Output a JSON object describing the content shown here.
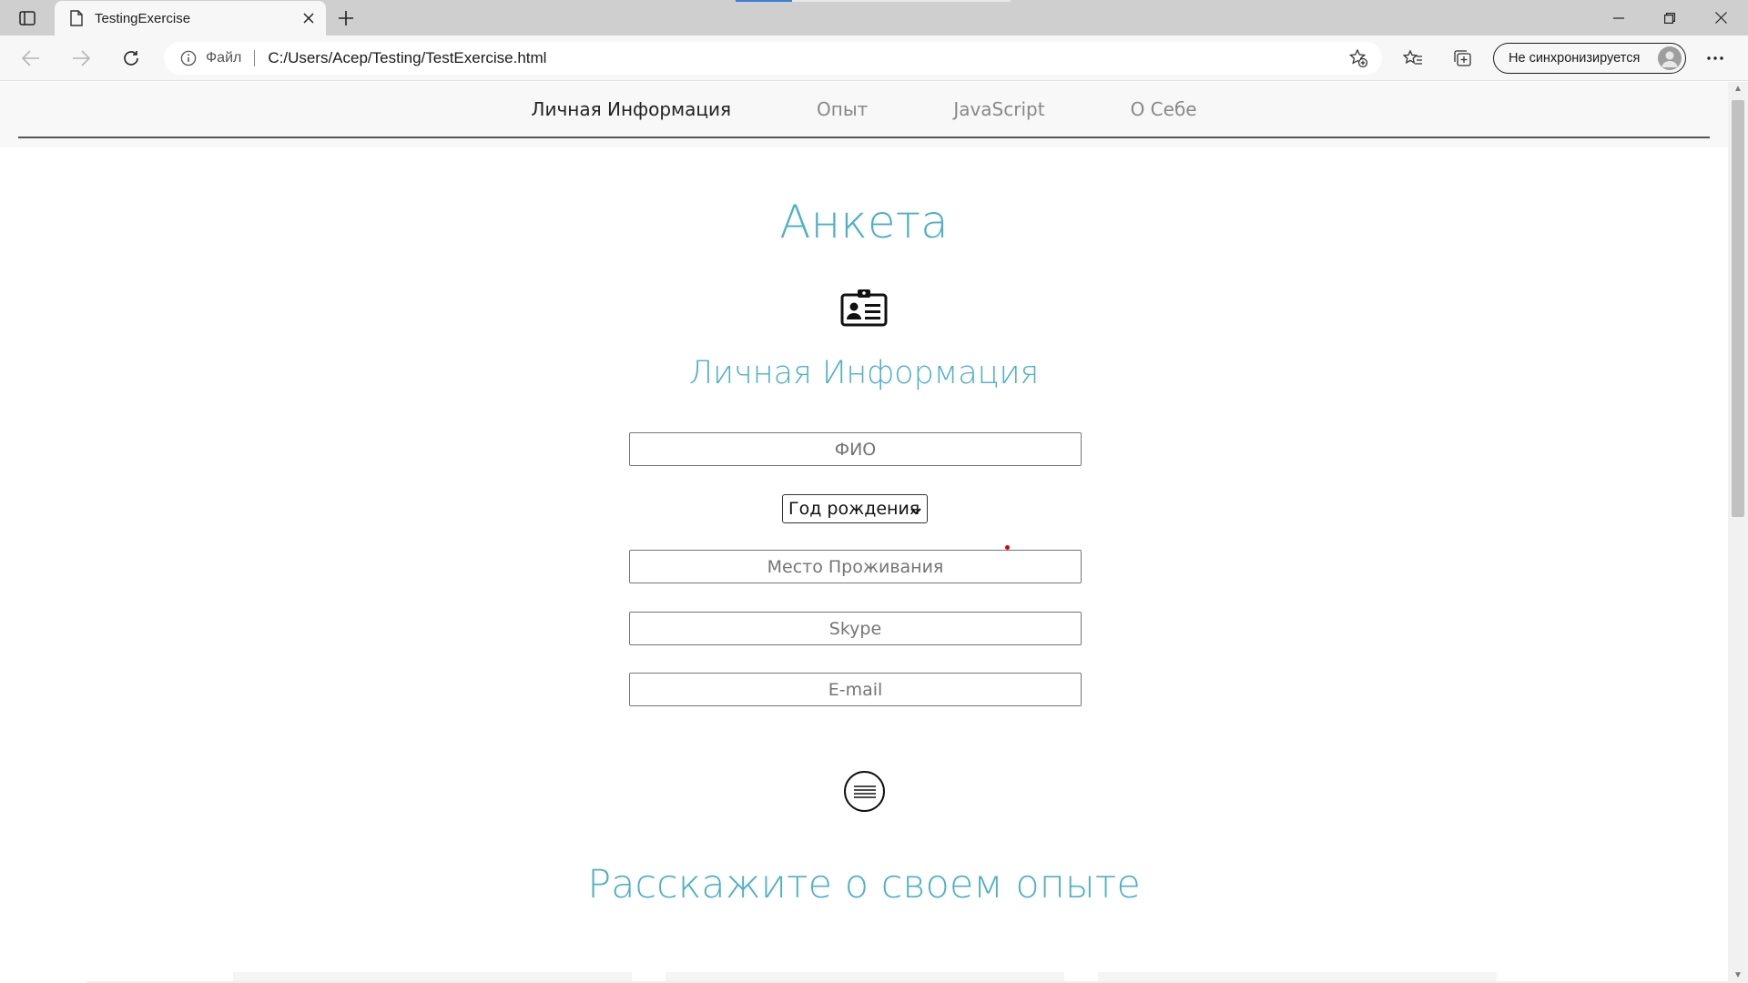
{
  "browser": {
    "tab_title": "TestingExercise",
    "address_scheme": "Файл",
    "address_url": "C:/Users/Acep/Testing/TestExercise.html",
    "profile_label": "Не синхронизируется",
    "icons": [
      "tab-actions-icon",
      "page-icon",
      "close-icon",
      "plus-icon",
      "minimize-icon",
      "restore-icon",
      "close-window-icon",
      "back-arrow-icon",
      "forward-arrow-icon",
      "refresh-icon",
      "info-icon",
      "add-favorite-icon",
      "favorites-icon",
      "collections-icon",
      "more-icon"
    ]
  },
  "nav": {
    "items": [
      {
        "label": "Личная Информация",
        "active": true
      },
      {
        "label": "Опыт",
        "active": false
      },
      {
        "label": "JavaScript",
        "active": false
      },
      {
        "label": "О Себе",
        "active": false
      }
    ]
  },
  "page": {
    "title": "Анкета",
    "section_title": "Личная Информация",
    "fields": {
      "fio_placeholder": "ФИО",
      "birth_year": "Год рождения",
      "residence_placeholder": "Место Проживания",
      "skype_placeholder": "Skype",
      "email_placeholder": "E-mail"
    },
    "experience_title": "Расскажите о своем опыте"
  },
  "colors": {
    "accent": "#4fb0c6",
    "marker": "#e00000"
  }
}
